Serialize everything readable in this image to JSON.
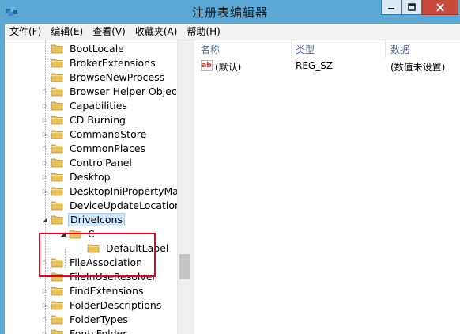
{
  "window": {
    "title": "注册表编辑器",
    "icon": "registry-editor-icon",
    "controls": [
      "minimize-icon",
      "maximize-icon",
      "close-icon"
    ]
  },
  "menu": [
    "文件(F)",
    "编辑(E)",
    "查看(V)",
    "收藏夹(A)",
    "帮助(H)"
  ],
  "tree": {
    "items": [
      {
        "label": "BootLocale",
        "expander": ""
      },
      {
        "label": "BrokerExtensions",
        "expander": ""
      },
      {
        "label": "BrowseNewProcess",
        "expander": ""
      },
      {
        "label": "Browser Helper Objects",
        "expander": "▷"
      },
      {
        "label": "Capabilities",
        "expander": "▷"
      },
      {
        "label": "CD Burning",
        "expander": "▷"
      },
      {
        "label": "CommandStore",
        "expander": "▷"
      },
      {
        "label": "CommonPlaces",
        "expander": "▷"
      },
      {
        "label": "ControlPanel",
        "expander": "▷"
      },
      {
        "label": "Desktop",
        "expander": "▷"
      },
      {
        "label": "DesktopIniPropertyMap",
        "expander": "▷"
      },
      {
        "label": "DeviceUpdateLocations",
        "expander": ""
      },
      {
        "label": "DriveIcons",
        "expander": "◢"
      },
      {
        "label": "C",
        "expander": "◢"
      },
      {
        "label": "DefaultLabel",
        "expander": ""
      },
      {
        "label": "FileAssociation",
        "expander": "▷"
      },
      {
        "label": "FileInUseResolver",
        "expander": ""
      },
      {
        "label": "FindExtensions",
        "expander": "▷"
      },
      {
        "label": "FolderDescriptions",
        "expander": "▷"
      },
      {
        "label": "FolderTypes",
        "expander": "▷"
      },
      {
        "label": "FontsFolder",
        "expander": "▷"
      }
    ]
  },
  "list": {
    "columns": [
      "名称",
      "类型",
      "数据"
    ],
    "rows": [
      {
        "icon": "string-value-icon",
        "icon_text": "ab",
        "name": "(默认)",
        "type": "REG_SZ",
        "data": "(数值未设置)"
      }
    ]
  },
  "colors": {
    "titlebar": "#5ba7d6",
    "folder": "#e8c35c",
    "highlight_box": "#e8001c",
    "close_button": "#c9493a"
  }
}
